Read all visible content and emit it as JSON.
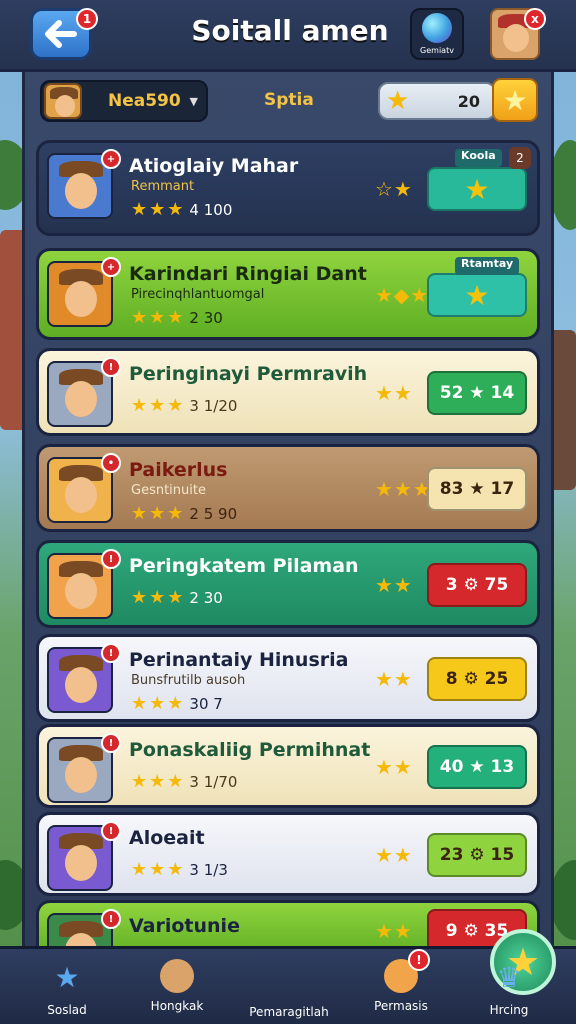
{
  "header": {
    "title": "Soitall amen",
    "back_badge": "1",
    "globe_label": "Gemiatv",
    "avatar_badge": "x"
  },
  "filter": {
    "selected": "Nea590",
    "center_label": "Sptia",
    "score": "20"
  },
  "colors": {
    "accent": "#f5c445",
    "panel": "#2c3a57",
    "red": "#e0262c"
  },
  "players": [
    {
      "name": "Atioglaiy Mahar",
      "sub": "Remmant",
      "stars": "★★★",
      "rating": "4 100",
      "mid": "☆★",
      "action": "★",
      "action_icon": "star",
      "tag": "Koola",
      "tagnum": "2",
      "badge": "+",
      "theme": "blue"
    },
    {
      "name": "Karindari Ringiai Dant",
      "sub": "Pirecinqhlantuomgal",
      "stars": "★★★",
      "rating": "2 30",
      "mid": "★◆★",
      "action": "★",
      "action_icon": "star",
      "tag": "Rtamtay",
      "badge": "+",
      "theme": "green"
    },
    {
      "name": "Peringinayi Permravih",
      "sub": "",
      "stars": "★★★",
      "rating": "3 1/20",
      "mid": "★★",
      "action": "52 ★ 14",
      "action_icon": "star",
      "badge": "!",
      "theme": "cream"
    },
    {
      "name": "Paikerlus",
      "sub": "Gesntinuite",
      "stars": "★★★",
      "rating": "2 5 90",
      "mid": "★★★",
      "action": "83 ★ 17",
      "action_icon": "star",
      "badge": "•",
      "theme": "brown"
    },
    {
      "name": "Peringkatem Pilaman",
      "sub": "",
      "stars": "★★★",
      "rating": "2 30",
      "mid": "★★",
      "action": "3 ⚙ 75",
      "action_icon": "gear",
      "badge": "!",
      "theme": "teal"
    },
    {
      "name": "Perinantaiy Hinusria",
      "sub": "Bunsfrutilb ausoh",
      "stars": "★★★",
      "rating": "30 7",
      "mid": "★★",
      "action": "8 ⚙ 25",
      "action_icon": "gear",
      "badge": "!",
      "theme": "white"
    },
    {
      "name": "Ponaskaliig Permihnat",
      "sub": "",
      "stars": "★★★",
      "rating": "3 1/70",
      "mid": "★★",
      "action": "40 ★ 13",
      "action_icon": "star",
      "badge": "!",
      "theme": "cream"
    },
    {
      "name": "Aloeait",
      "sub": "",
      "stars": "★★★",
      "rating": "3 1/3",
      "mid": "★★",
      "action": "23 ⚙ 15",
      "action_icon": "gear",
      "badge": "!",
      "theme": "white"
    },
    {
      "name": "Variotunie",
      "sub": "",
      "stars": "★★★",
      "rating": "",
      "mid": "★★",
      "action": "9 ⚙ 35",
      "action_icon": "gear",
      "badge": "!",
      "theme": "lime"
    }
  ],
  "nav": [
    {
      "label": "Soslad",
      "icon": "star-icon"
    },
    {
      "label": "Hongkak",
      "icon": "profile-icon"
    },
    {
      "label": "Pemaragitlah",
      "icon": "center-star-icon"
    },
    {
      "label": "Permasis",
      "icon": "character-icon",
      "badge": "!"
    },
    {
      "label": "Hrcing",
      "icon": "trophy-icon"
    }
  ]
}
